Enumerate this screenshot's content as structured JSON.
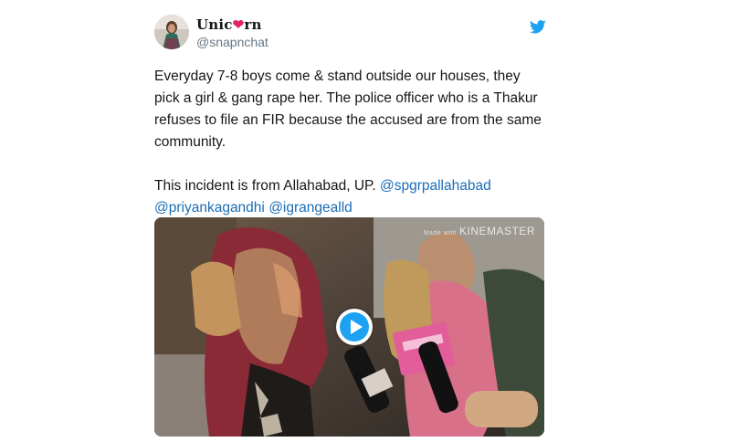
{
  "tweet": {
    "display_name_prefix": "Unic",
    "display_name_heart": "❤",
    "display_name_suffix": "rn",
    "handle": "@snapnchat",
    "icon": "twitter-bird-icon",
    "text_line1": "Everyday 7-8 boys come & stand outside our houses, they pick a girl & gang rape her. The police officer who is a Thakur refuses to file an FIR because the accused are from the same community.",
    "text_line2": "This incident is from Allahabad, UP.",
    "mentions": [
      "@spgrpallahabad",
      "@priyankagandhi",
      "@igrangealld"
    ]
  },
  "media": {
    "watermark_small": "Made with",
    "watermark": "KINEMASTER",
    "play_icon": "play-icon"
  },
  "colors": {
    "accent": "#1da1f2",
    "mention": "#1b6db5",
    "text": "#14171a",
    "muted": "#657786",
    "heart": "#e0245e"
  }
}
